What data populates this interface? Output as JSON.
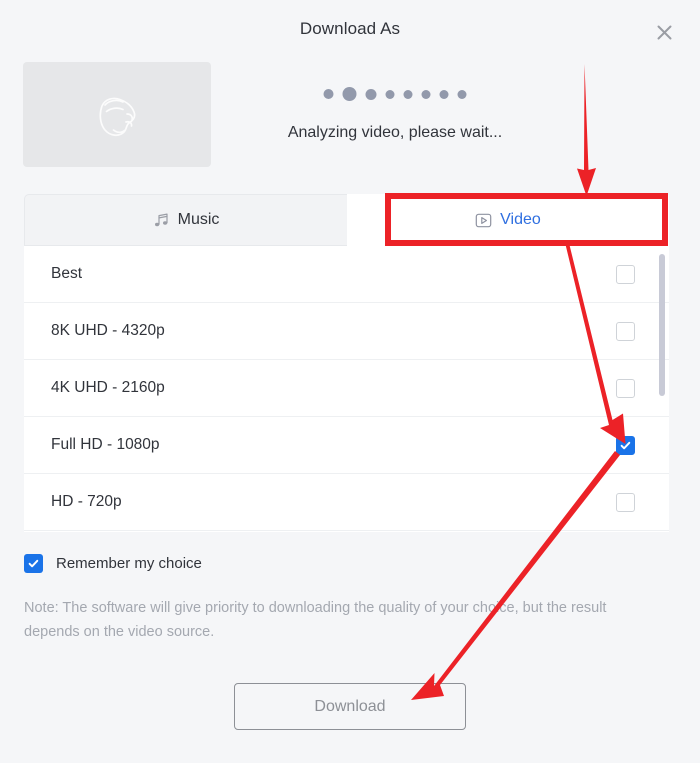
{
  "dialog": {
    "title": "Download As",
    "close_icon": "close-icon"
  },
  "thumbnail": {
    "icon": "image-placeholder-icon",
    "alt": ""
  },
  "status": {
    "text": "Analyzing video, please wait...",
    "dots": [
      {
        "size": 10,
        "opacity": 1
      },
      {
        "size": 14,
        "opacity": 1
      },
      {
        "size": 11,
        "opacity": 1
      },
      {
        "size": 9,
        "opacity": 1
      },
      {
        "size": 9,
        "opacity": 1
      },
      {
        "size": 9,
        "opacity": 1
      },
      {
        "size": 9,
        "opacity": 1
      },
      {
        "size": 9,
        "opacity": 1
      }
    ]
  },
  "tabs": [
    {
      "id": "music",
      "label": "Music",
      "icon": "music-note-icon",
      "active": false
    },
    {
      "id": "video",
      "label": "Video",
      "icon": "play-box-icon",
      "active": true
    }
  ],
  "quality_list": [
    {
      "label": "Best",
      "checked": false
    },
    {
      "label": "8K UHD - 4320p",
      "checked": false
    },
    {
      "label": "4K UHD - 2160p",
      "checked": false
    },
    {
      "label": "Full HD - 1080p",
      "checked": true
    },
    {
      "label": "HD - 720p",
      "checked": false
    }
  ],
  "remember": {
    "label": "Remember my choice",
    "checked": true
  },
  "note": {
    "text": "Note: The software will give priority to downloading the quality of your choice, but the result depends on the video source."
  },
  "footer": {
    "download_label": "Download"
  },
  "colors": {
    "accent_blue": "#1a73e8",
    "tab_active_text": "#2f6fe0",
    "annotation_red": "#ec2227",
    "page_background": "#f5f6f8",
    "list_background": "#ffffff",
    "muted_text": "#a4a8b0"
  },
  "annotations": {
    "highlight_target": "Video",
    "arrows": [
      {
        "name": "arrow-to-video-tab",
        "points_at": "Video"
      },
      {
        "name": "arrow-to-1080p-checkbox",
        "points_at": "Full HD - 1080p"
      },
      {
        "name": "arrow-to-download-button",
        "points_at": "Download"
      }
    ]
  }
}
